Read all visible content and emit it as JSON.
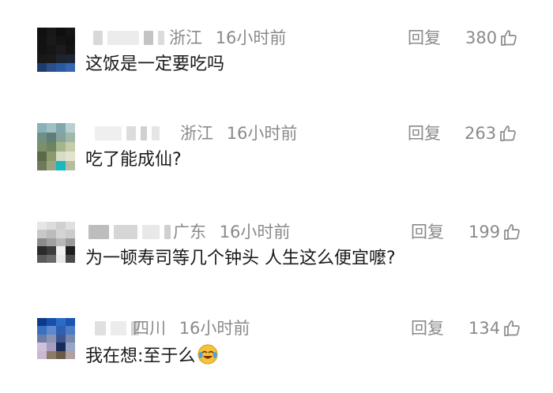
{
  "comments": [
    {
      "location": "浙江",
      "time": "16小时前",
      "text": "这饭是一定要吃吗",
      "reply_label": "回复",
      "likes": "380",
      "avatar_colors": [
        "#101010",
        "#181818",
        "#0f0f0f",
        "#151515",
        "#121212",
        "#1a1a1a",
        "#141414",
        "#111111",
        "#131313",
        "#161616",
        "#1c1c1c",
        "#141414",
        "#181818",
        "#1a1a1a",
        "#1d2430",
        "#1b2535",
        "#1f3b6e",
        "#2c4f8a",
        "#2a5aa0",
        "#3566b0"
      ]
    },
    {
      "location": "浙江",
      "time": "16小时前",
      "text": "吃了能成仙?",
      "reply_label": "回复",
      "likes": "263",
      "avatar_colors": [
        "#8ab0b8",
        "#a0c0c4",
        "#7fa7ad",
        "#b9d0d0",
        "#6f8f88",
        "#5f7e78",
        "#86a39b",
        "#9fb8a8",
        "#7b8f6a",
        "#6e8460",
        "#a5b58b",
        "#c4ccaa",
        "#5c6a48",
        "#8c9a70",
        "#d7dcc4",
        "#e3e2cf",
        "#70795a",
        "#9aa37e",
        "#18b8c0",
        "#b6bca0"
      ]
    },
    {
      "location": "广东",
      "time": "16小时前",
      "text": "为一顿寿司等几个钟头 人生这么便宜嚒?",
      "reply_label": "回复",
      "likes": "199",
      "avatar_colors": [
        "#e6e6e6",
        "#dcdcdc",
        "#d0d0d0",
        "#e0e0e0",
        "#c8c8c8",
        "#bcbcbc",
        "#d4d4d4",
        "#cccccc",
        "#8a8a8a",
        "#a0a0a0",
        "#b8b8b8",
        "#9a9a9a",
        "#2a2a2a",
        "#3c3c3c",
        "#f0f0f0",
        "#1e1e1e",
        "#5a5a5a",
        "#6a6a6a",
        "#e8e8e8",
        "#4a4a4a"
      ]
    },
    {
      "location": "四川",
      "time": "16小时前",
      "text": "我在想:至于么",
      "reply_label": "回复",
      "likes": "134",
      "avatar_colors": [
        "#0b3a8a",
        "#1a4fa8",
        "#2a6cc8",
        "#1c55b0",
        "#3a70c0",
        "#5b8ad0",
        "#2e5fb0",
        "#4a7cc8",
        "#6a7ea8",
        "#8c94b4",
        "#3c5690",
        "#7a88b0",
        "#d0c0d8",
        "#a89cc0",
        "#1a2a58",
        "#9aa4c4",
        "#c8b8d0",
        "#8a7a68",
        "#6a5a4a",
        "#b0a0a0"
      ]
    }
  ]
}
